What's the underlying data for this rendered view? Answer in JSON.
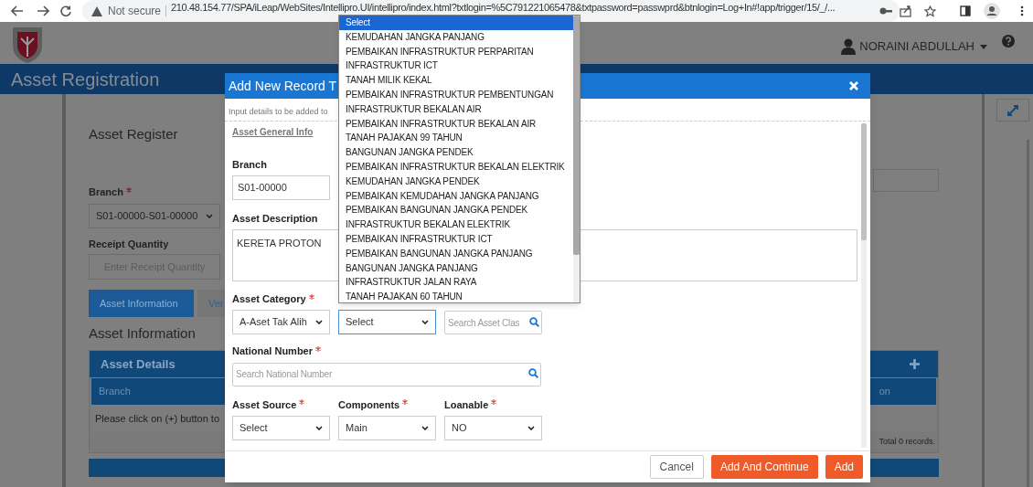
{
  "browser": {
    "security": "Not secure",
    "url": "210.48.154.77/SPA/iLeap/WebSites/Intellipro.UI/intellipro/index.html?txtlogin=%5C791221065478&txtpassword=passwprd&btnlogin=Log+In#!app/trigger/15/_/..."
  },
  "header": {
    "user": "NORAINI ABDULLAH"
  },
  "page_title": "Asset Registration",
  "register": {
    "title": "Asset Register",
    "branch": {
      "label": "Branch",
      "required": true,
      "value": "S01-00000-S01-00000"
    },
    "receipt_quantity": {
      "label": "Receipt Quantity",
      "placeholder": "Enter Receipt Quantity"
    },
    "tabs": [
      {
        "label": "Asset Information",
        "selected": true
      },
      {
        "label": "Ver",
        "selected": false
      }
    ],
    "section_title": "Asset Information",
    "panel": {
      "title": "Asset Details",
      "columns": [
        "Branch",
        "on"
      ],
      "empty_message": "Please click on (+) button to",
      "footer": "Total 0 records."
    }
  },
  "modal": {
    "title": "Add New Record T",
    "subtitle": "Input details to be added to",
    "section": "Asset General Info",
    "rows": [
      [
        {
          "kind": "text",
          "label": "Branch",
          "value": "S01-00000"
        }
      ],
      [
        {
          "kind": "textarea",
          "label": "Asset Description",
          "value": "KERETA PROTON"
        }
      ],
      [
        {
          "kind": "select",
          "label": "Asset Category",
          "required": true,
          "value": "A-Aset Tak Alih",
          "focused": false
        },
        {
          "kind": "select",
          "value": "Select",
          "focused": true
        },
        {
          "kind": "search",
          "placeholder": "Search Asset Clas"
        }
      ],
      [
        {
          "kind": "search",
          "label": "National Number",
          "required": true,
          "placeholder": "Search National Number"
        }
      ],
      [
        {
          "kind": "select",
          "label": "Asset Source",
          "required": true,
          "value": "Select",
          "focused": false
        },
        {
          "kind": "select",
          "label": "Components",
          "required": true,
          "value": "Main",
          "focused": false
        },
        {
          "kind": "select",
          "label": "Loanable",
          "required": true,
          "value": "NO",
          "focused": false
        }
      ]
    ],
    "buttons": [
      {
        "label": "Cancel",
        "kind": "secondary"
      },
      {
        "label": "Add And Continue",
        "kind": "primary"
      },
      {
        "label": "Add",
        "kind": "primary"
      }
    ]
  },
  "dropdown": {
    "options": [
      {
        "label": "Select",
        "selected": true
      },
      {
        "label": "KEMUDAHAN JANGKA PANJANG",
        "selected": false
      },
      {
        "label": "PEMBAIKAN INFRASTRUKTUR PERPARITAN",
        "selected": false
      },
      {
        "label": "INFRASTRUKTUR ICT",
        "selected": false
      },
      {
        "label": "TANAH MILIK KEKAL",
        "selected": false
      },
      {
        "label": "PEMBAIKAN INFRASTRUKTUR PEMBENTUNGAN",
        "selected": false
      },
      {
        "label": "INFRASTRUKTUR BEKALAN AIR",
        "selected": false
      },
      {
        "label": "PEMBAIKAN INFRASTRUKTUR BEKALAN AIR",
        "selected": false
      },
      {
        "label": "TANAH PAJAKAN 99 TAHUN",
        "selected": false
      },
      {
        "label": "BANGUNAN JANGKA PENDEK",
        "selected": false
      },
      {
        "label": "PEMBAIKAN INFRASTRUKTUR BEKALAN ELEKTRIK",
        "selected": false
      },
      {
        "label": "KEMUDAHAN JANGKA PENDEK",
        "selected": false
      },
      {
        "label": "PEMBAIKAN KEMUDAHAN JANGKA PANJANG",
        "selected": false
      },
      {
        "label": "PEMBAIKAN BANGUNAN JANGKA PENDEK",
        "selected": false
      },
      {
        "label": "INFRASTRUKTUR BEKALAN ELEKTRIK",
        "selected": false
      },
      {
        "label": "PEMBAIKAN INFRASTRUKTUR ICT",
        "selected": false
      },
      {
        "label": "PEMBAIKAN BANGUNAN JANGKA PANJANG",
        "selected": false
      },
      {
        "label": "BANGUNAN JANGKA PANJANG",
        "selected": false
      },
      {
        "label": "INFRASTRUKTUR JALAN RAYA",
        "selected": false
      },
      {
        "label": "TANAH PAJAKAN 60 TAHUN",
        "selected": false
      }
    ]
  }
}
